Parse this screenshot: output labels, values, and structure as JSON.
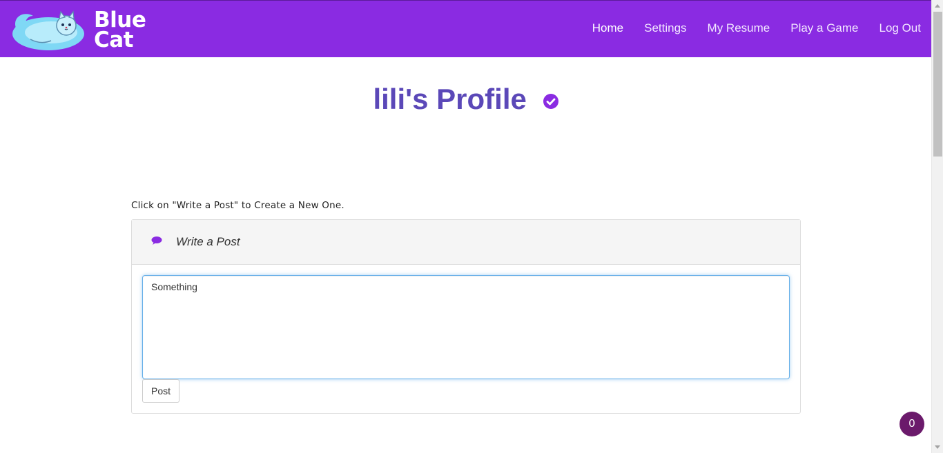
{
  "brand": {
    "name_line1": "Blue",
    "name_line2": "Cat"
  },
  "nav": {
    "items": [
      {
        "label": "Home",
        "active": true
      },
      {
        "label": "Settings",
        "active": false
      },
      {
        "label": "My Resume",
        "active": false
      },
      {
        "label": "Play a Game",
        "active": false
      },
      {
        "label": "Log Out",
        "active": false
      }
    ]
  },
  "profile": {
    "title": "lili's Profile",
    "verified_icon": "check-circle-icon"
  },
  "composer": {
    "hint": "Click on \"Write a Post\" to Create a New One.",
    "heading_icon": "comment-icon",
    "heading": "Write a Post",
    "text_value": "Something",
    "post_label": "Post"
  },
  "notifications": {
    "count": "0"
  },
  "colors": {
    "navbar": "#8a2be2",
    "title": "#5b48b8",
    "accent": "#8a2be2",
    "badge": "#6b1a6b"
  }
}
